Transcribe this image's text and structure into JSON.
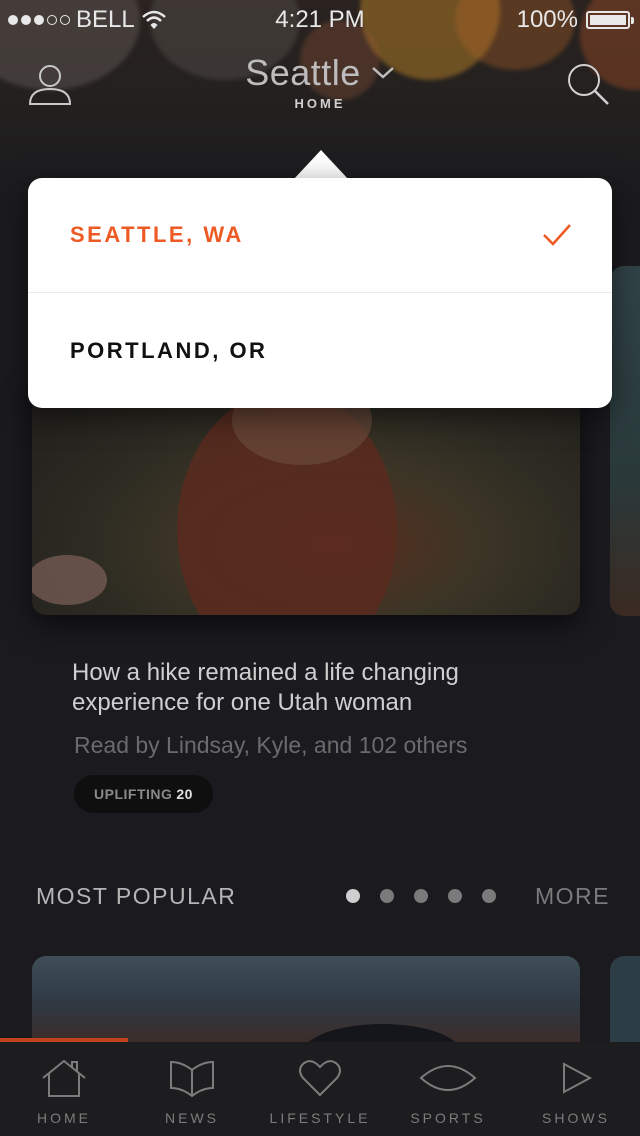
{
  "status_bar": {
    "carrier": "BELL",
    "time": "4:21 PM",
    "battery": "100%"
  },
  "header": {
    "city": "Seattle",
    "subtitle": "HOME"
  },
  "location_dropdown": {
    "options": [
      {
        "label": "SEATTLE, WA",
        "selected": true
      },
      {
        "label": "PORTLAND, OR",
        "selected": false
      }
    ],
    "accent_color": "#ee5a24"
  },
  "featured_story": {
    "headline": "How a hike remained a life changing experience for one Utah woman",
    "read_by": "Read by Lindsay, Kyle, and 102 others",
    "tag_label": "UPLIFTING",
    "tag_count": "20"
  },
  "most_popular": {
    "title": "MOST POPULAR",
    "more_label": "MORE",
    "page_count": 5,
    "active_page": 1
  },
  "tab_bar": {
    "items": [
      {
        "label": "HOME",
        "icon": "home-icon"
      },
      {
        "label": "NEWS",
        "icon": "news-icon"
      },
      {
        "label": "LIFESTYLE",
        "icon": "heart-icon"
      },
      {
        "label": "SPORTS",
        "icon": "football-icon"
      },
      {
        "label": "SHOWS",
        "icon": "play-icon"
      }
    ],
    "active_progress": 0.2
  }
}
